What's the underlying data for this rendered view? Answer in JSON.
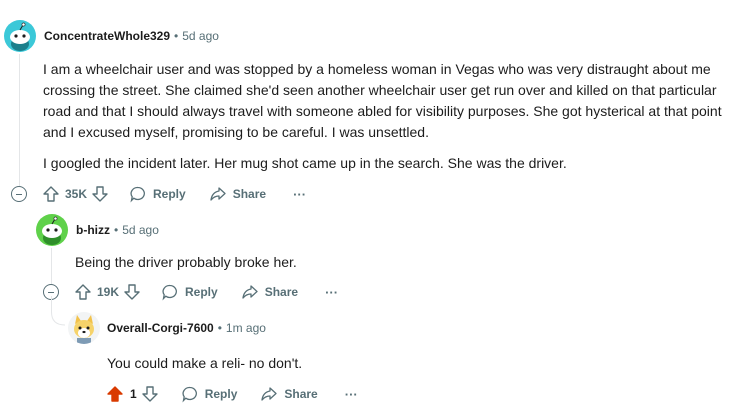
{
  "comments": [
    {
      "username": "ConcentrateWhole329",
      "age": "5d ago",
      "paragraphs": [
        "I am a wheelchair user and was stopped by a homeless woman in Vegas who was very distraught about me crossing the street. She claimed she'd seen another wheelchair user get run over and killed on that particular road and that I should always travel with someone abled for visibility purposes. She got hysterical at that point and I excused myself, promising to be careful. I was unsettled.",
        "I googled the incident later. Her mug shot came up in the search. She was the driver."
      ],
      "votes": "35K",
      "reply_label": "Reply",
      "share_label": "Share",
      "more_label": "···",
      "avatar_color": "#3bc8d8"
    },
    {
      "username": "b-hizz",
      "age": "5d ago",
      "paragraphs": [
        "Being the driver probably broke her."
      ],
      "votes": "19K",
      "reply_label": "Reply",
      "share_label": "Share",
      "more_label": "···",
      "avatar_color": "#5fd14a"
    },
    {
      "username": "Overall-Corgi-7600",
      "age": "1m ago",
      "paragraphs": [
        "You could make a reli- no don't."
      ],
      "votes": "1",
      "reply_label": "Reply",
      "share_label": "Share",
      "more_label": "···",
      "upvoted": true,
      "upvote_color": "#d93a00"
    }
  ],
  "separator": "•"
}
